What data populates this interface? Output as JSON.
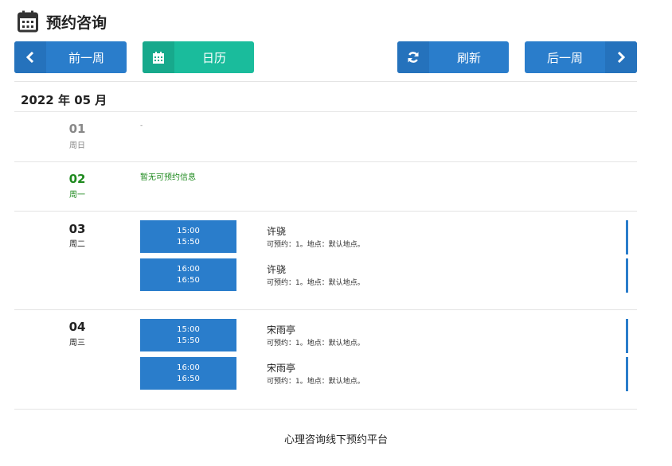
{
  "header": {
    "title": "预约咨询",
    "icon": "calendar-icon"
  },
  "toolbar": {
    "prev_week": "前一周",
    "calendar": "日历",
    "refresh": "刷新",
    "next_week": "后一周"
  },
  "month_label": "2022 年 05 月",
  "days": [
    {
      "num": "01",
      "week": "周日",
      "note": "-"
    },
    {
      "num": "02",
      "week": "周一",
      "note": "暂无可预约信息"
    },
    {
      "num": "03",
      "week": "周二",
      "slots": [
        {
          "start": "15:00",
          "end": "15:50",
          "name": "许骁",
          "info": "可预约：1。地点：默认地点。"
        },
        {
          "start": "16:00",
          "end": "16:50",
          "name": "许骁",
          "info": "可预约：1。地点：默认地点。"
        }
      ]
    },
    {
      "num": "04",
      "week": "周三",
      "slots": [
        {
          "start": "15:00",
          "end": "15:50",
          "name": "宋雨亭",
          "info": "可预约：1。地点：默认地点。"
        },
        {
          "start": "16:00",
          "end": "16:50",
          "name": "宋雨亭",
          "info": "可预约：1。地点：默认地点。"
        }
      ]
    }
  ],
  "caption": "心理咨询线下预约平台",
  "colors": {
    "primary": "#2a7dcb",
    "teal": "#1abc9c",
    "green_text": "#1f8a1f"
  }
}
